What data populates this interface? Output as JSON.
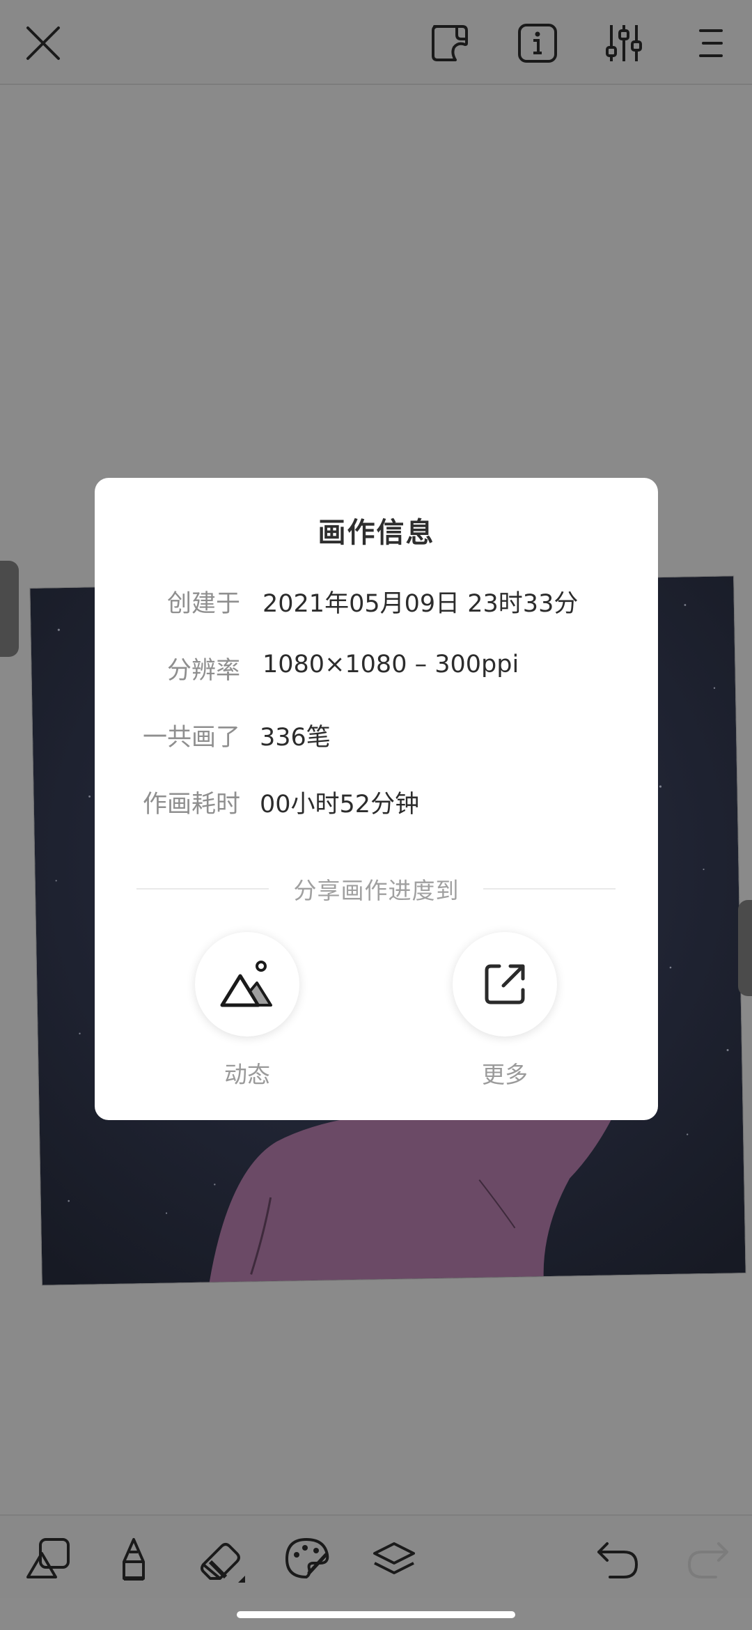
{
  "toolbar_top": {
    "icons": [
      "close-icon",
      "sticker-icon",
      "info-icon",
      "adjust-sliders-icon",
      "menu-icon"
    ]
  },
  "modal": {
    "title": "画作信息",
    "rows": [
      {
        "label": "创建于",
        "value": "2021年05月09日 23时33分"
      },
      {
        "label": "分辨率",
        "value": "1080×1080 – 300ppi"
      },
      {
        "label": "一共画了",
        "value": "336笔"
      },
      {
        "label": "作画耗时",
        "value": "00小时52分钟"
      }
    ],
    "share_heading": "分享画作进度到",
    "share_options": [
      {
        "label": "动态",
        "icon": "moments-mountain-icon"
      },
      {
        "label": "更多",
        "icon": "external-share-icon"
      }
    ]
  },
  "toolbar_bottom": {
    "icons": [
      "shapes-icon",
      "pencil-icon",
      "eraser-icon",
      "palette-icon",
      "layers-icon",
      "undo-icon",
      "redo-icon"
    ]
  },
  "colors": {
    "overlay": "#8a8a8a",
    "modal_bg": "#ffffff",
    "art_night": "#1f2330",
    "art_figure": "#6b4a66"
  }
}
